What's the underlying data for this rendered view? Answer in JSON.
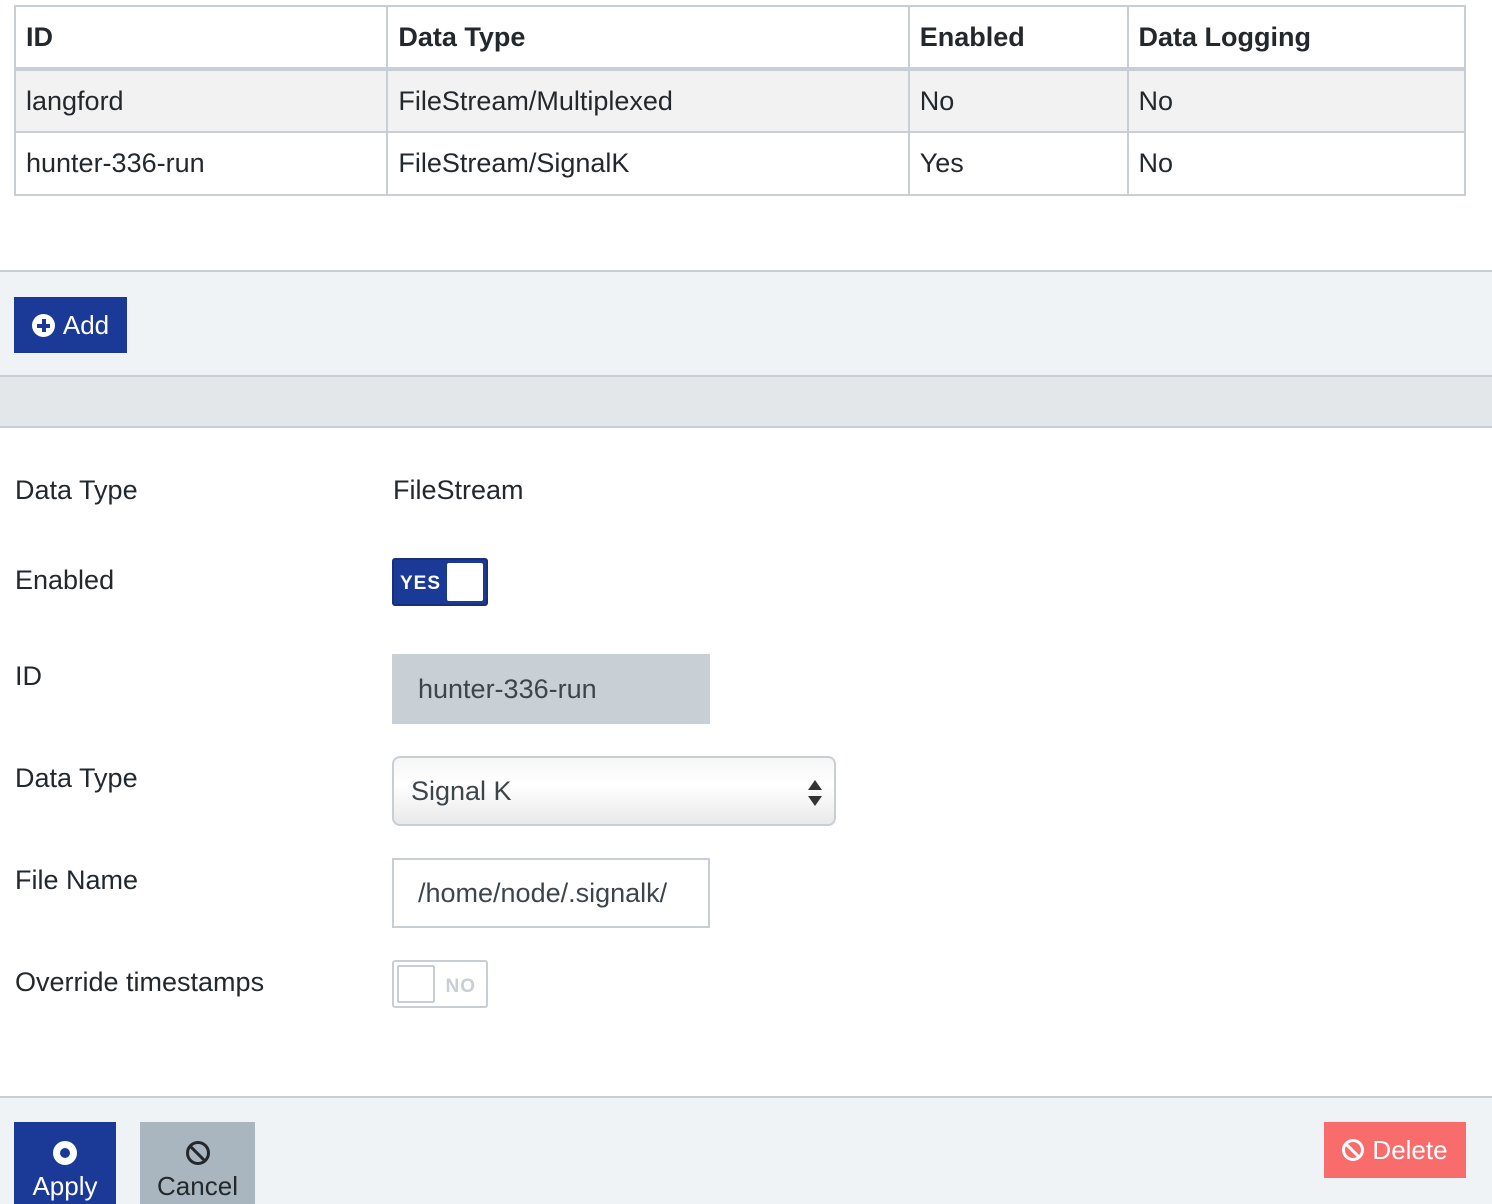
{
  "table": {
    "headers": [
      "ID",
      "Data Type",
      "Enabled",
      "Data Logging"
    ],
    "rows": [
      {
        "id": "langford",
        "data_type": "FileStream/Multiplexed",
        "enabled": "No",
        "data_logging": "No"
      },
      {
        "id": "hunter-336-run",
        "data_type": "FileStream/SignalK",
        "enabled": "Yes",
        "data_logging": "No"
      }
    ]
  },
  "add_bar": {
    "add_label": "Add",
    "icon": "plus-circle-icon"
  },
  "form": {
    "data_type_label": "Data Type",
    "data_type_value": "FileStream",
    "enabled_label": "Enabled",
    "enabled_switch": {
      "state": "on",
      "text": "YES"
    },
    "id_label": "ID",
    "id_value": "hunter-336-run",
    "data_type2_label": "Data Type",
    "data_type2_selected": "Signal K",
    "file_name_label": "File Name",
    "file_name_value": "/home/node/.signalk/",
    "override_label": "Override timestamps",
    "override_switch": {
      "state": "off",
      "text": "NO"
    }
  },
  "footer": {
    "apply_label": "Apply",
    "cancel_label": "Cancel",
    "delete_label": "Delete"
  },
  "colors": {
    "primary": "#1b3a97",
    "danger": "#f86c6b",
    "secondary": "#a9b6bf",
    "border": "#c8ced3",
    "footer_bg": "#f0f3f5"
  }
}
